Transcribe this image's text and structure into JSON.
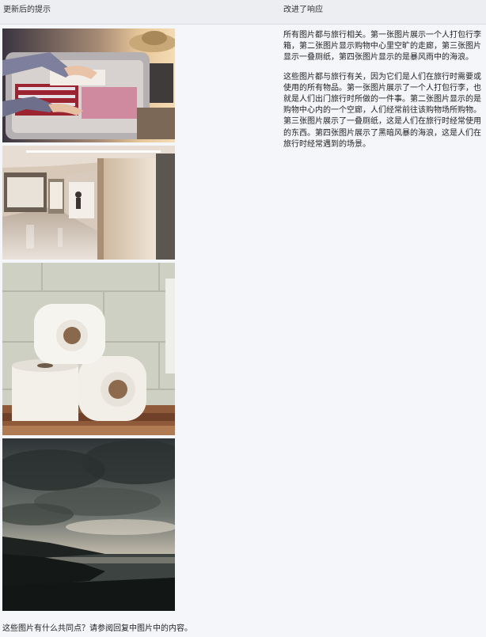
{
  "header": {
    "left_title": "更新后的提示",
    "right_title": "改进了响应"
  },
  "prompt": {
    "text": "这些图片有什么共同点？请参阅回复中图片中的内容。"
  },
  "response": {
    "paragraphs": [
      "所有图片都与旅行相关。第一张图片展示一个人打包行李箱，第二张图片显示购物中心里空旷的走廊，第三张图片显示一叠厕纸，第四张图片显示的是暴风雨中的海浪。",
      "这些图片都与旅行有关，因为它们是人们在旅行时需要或使用的所有物品。第一张图片展示了一个人打包行李，也就是人们出门旅行时所做的一件事。第二张图片显示的是购物中心内的一个空廊，人们经常前往该购物场所购物。第三张图片展示了一叠厕纸，这是人们在旅行时经常使用的东西。第四张图片展示了黑暗风暴的海浪，这是人们在旅行时经常遇到的场景。"
    ]
  },
  "images": [
    {
      "name": "packing-suitcase-image"
    },
    {
      "name": "shopping-mall-corridor-image"
    },
    {
      "name": "toilet-paper-rolls-image"
    },
    {
      "name": "stormy-sea-image"
    }
  ],
  "colors": {
    "header_bg": "#eceef2",
    "page_bg": "#f5f6f9"
  }
}
